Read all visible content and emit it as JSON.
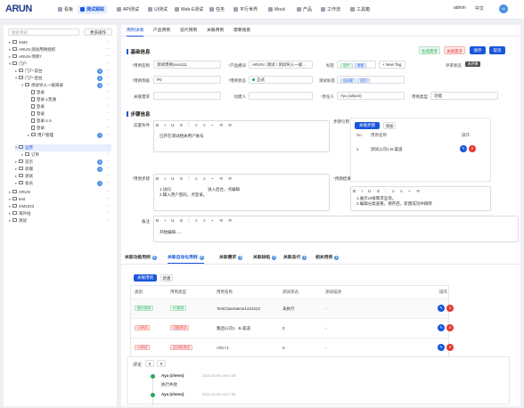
{
  "header": {
    "logo": "ARUN",
    "nav": [
      {
        "label": "看板"
      },
      {
        "label": "测试跟踪"
      },
      {
        "label": "API测试"
      },
      {
        "label": "UI测试"
      },
      {
        "label": "Web-E测试"
      },
      {
        "label": "任务"
      },
      {
        "label": "平行世界"
      },
      {
        "label": "Mock"
      },
      {
        "label": "产品"
      },
      {
        "label": "工作流"
      },
      {
        "label": "工具箱"
      }
    ],
    "right_items": [
      "admin",
      "中文",
      "Ai"
    ]
  },
  "sidebar": {
    "search_placeholder": "搜索目录",
    "more_label": "更多操作",
    "tree": [
      {
        "label": "GM2",
        "type": "folder",
        "level": 0,
        "expanded": false
      },
      {
        "label": "ARUN-测试用例组织",
        "type": "folder",
        "level": 0,
        "expanded": false
      },
      {
        "label": "ARUN-项目7",
        "type": "folder",
        "level": 0,
        "expanded": false
      },
      {
        "label": "门户",
        "type": "folder",
        "level": 0,
        "expanded": true
      },
      {
        "label": "门户-前台",
        "type": "folder",
        "level": 1,
        "expanded": false,
        "count": "9"
      },
      {
        "label": "门户-后台",
        "type": "folder",
        "level": 1,
        "expanded": true,
        "count": "6"
      },
      {
        "label": "测试导入一级目录",
        "type": "folder",
        "level": 2,
        "expanded": true,
        "count": "4"
      },
      {
        "label": "登录",
        "type": "doc",
        "level": 3
      },
      {
        "label": "登录-1普通",
        "type": "doc",
        "level": 3
      },
      {
        "label": "登录",
        "type": "doc",
        "level": 3
      },
      {
        "label": "登录",
        "type": "doc",
        "level": 3
      },
      {
        "label": "登录-1.5",
        "type": "doc",
        "level": 3
      },
      {
        "label": "登录",
        "type": "doc",
        "level": 3
      },
      {
        "label": "用户管理",
        "type": "folder",
        "level": 3,
        "count": "1"
      },
      {
        "label": "运营",
        "type": "folder",
        "level": 1,
        "expanded": true,
        "selected": true
      },
      {
        "label": "订单",
        "type": "folder",
        "level": 2
      },
      {
        "label": "首页",
        "type": "folder",
        "level": 1,
        "count": "6"
      },
      {
        "label": "前端",
        "type": "folder",
        "level": 1,
        "count": "3"
      },
      {
        "label": "测试",
        "type": "folder",
        "level": 1
      },
      {
        "label": "会员",
        "type": "folder",
        "level": 1,
        "count": "1"
      },
      {
        "label": "ARUN",
        "type": "folder",
        "level": 0
      },
      {
        "label": "test",
        "type": "folder",
        "level": 0
      },
      {
        "label": "GM2223",
        "type": "folder",
        "level": 0
      },
      {
        "label": "海外站",
        "type": "folder",
        "level": 0
      },
      {
        "label": "测试",
        "type": "folder",
        "level": 0
      }
    ]
  },
  "main": {
    "tabs": [
      "用例详情",
      "产品用例",
      "迭代用例",
      "关联用例",
      "需要搜索"
    ],
    "basic": {
      "title": "基础信息",
      "actions": [
        "生成需求",
        "关联需求",
        "保存",
        "取消"
      ],
      "case_name_label": "用例名称",
      "case_name": "测试用例xxxx111",
      "product_module_label": "产品模块",
      "product_module": "ARUN / 测试 / 测试导入一级...",
      "tags_label": "标签",
      "tags": [
        "用户",
        "其他"
      ],
      "new_tag": "+ New Tag",
      "review_status_label": "评审状态",
      "review_status": "未评审",
      "priority_label": "用例等级",
      "priority": "P0",
      "case_status_label": "用例状态",
      "case_status": "正式",
      "tag2_label": "测试标签",
      "tag2": [
        "自动化",
        "回归"
      ],
      "link_req_label": "关联需求",
      "link_req": "",
      "creator_label": "创建人",
      "creator": "",
      "reporter_label": "责任人",
      "reporter": "Ayu (aliyun)",
      "type_label": "用例类型",
      "type": "功能"
    },
    "steps": {
      "title": "步骤信息",
      "precondition_label": "前置条件",
      "precondition_text": "已存在测试相关用户账号",
      "sub_steps_label": "步骤引用",
      "add_btn": "关联步骤",
      "add_btn2": "添加",
      "ref_headers": [
        "No.",
        "用例名称",
        "操作"
      ],
      "ref_rows": [
        {
          "no": "1",
          "name": "测试公司1·B-渠道"
        }
      ],
      "step_label": "用例步骤",
      "step_text": [
        "1.访问",
        "2.输入用户密码，点登录。"
      ],
      "step_text2": "进入后台，点编辑",
      "expected_label": "预期结果",
      "expected_text": [
        "1.展示UI按需求呈现。",
        "2.编辑分类查看。保存后，新建成功并跳转"
      ],
      "remark_label": "备注",
      "remark_text": "开始编辑......"
    },
    "bottom_tabs": [
      {
        "label": "关联功能用例",
        "count": "3"
      },
      {
        "label": "关联自动化用例",
        "count": "3",
        "active": true
      },
      {
        "label": "关联需求",
        "count": "3"
      },
      {
        "label": "关联缺陷",
        "count": "1"
      },
      {
        "label": "关联迭代",
        "count": "1"
      },
      {
        "label": "相关用例",
        "count": "1"
      }
    ],
    "relate": {
      "btn_primary": "关联用例",
      "btn_secondary": "新建",
      "headers": [
        "类别",
        "用例类型",
        "用例名称",
        "测试状态",
        "测试描述",
        "状态",
        "操作"
      ],
      "rows": [
        {
          "category": "接口测试",
          "type": "P2测试",
          "name": "TestClassName1222222",
          "status": "未执行",
          "desc": "-"
        },
        {
          "category": "UI测试",
          "type": "功能测试",
          "name": "集团公司1 · B-渠道",
          "status": "0",
          "desc": "-"
        },
        {
          "category": "UI测试",
          "type": "自动化测试",
          "name": "ATcr+1",
          "status": "0",
          "desc": "-"
        }
      ]
    },
    "comments": {
      "label": "评论",
      "count_a": "0",
      "count_b": "0",
      "items": [
        {
          "user": "Aya (chens)",
          "time": "2022-01-09 10:47:28",
          "text": "执行失败"
        },
        {
          "user": "Aya (chens)",
          "time": "2022-01-09 10:47:30",
          "text": ""
        }
      ]
    }
  }
}
